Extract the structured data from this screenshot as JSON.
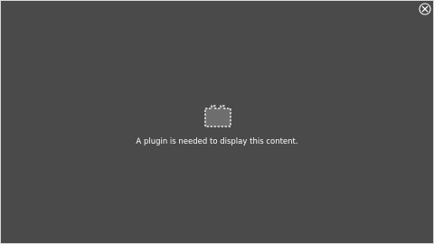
{
  "plugin_placeholder": {
    "message": "A plugin is needed to display this content.",
    "icon": "plugin-block-icon",
    "close_icon": "close-circle-icon",
    "colors": {
      "background": "#4a4a4a",
      "border": "#d8d8d8",
      "text": "#ffffff",
      "icon_fill": "#6e6e6e",
      "icon_outline": "#ffffff"
    }
  }
}
